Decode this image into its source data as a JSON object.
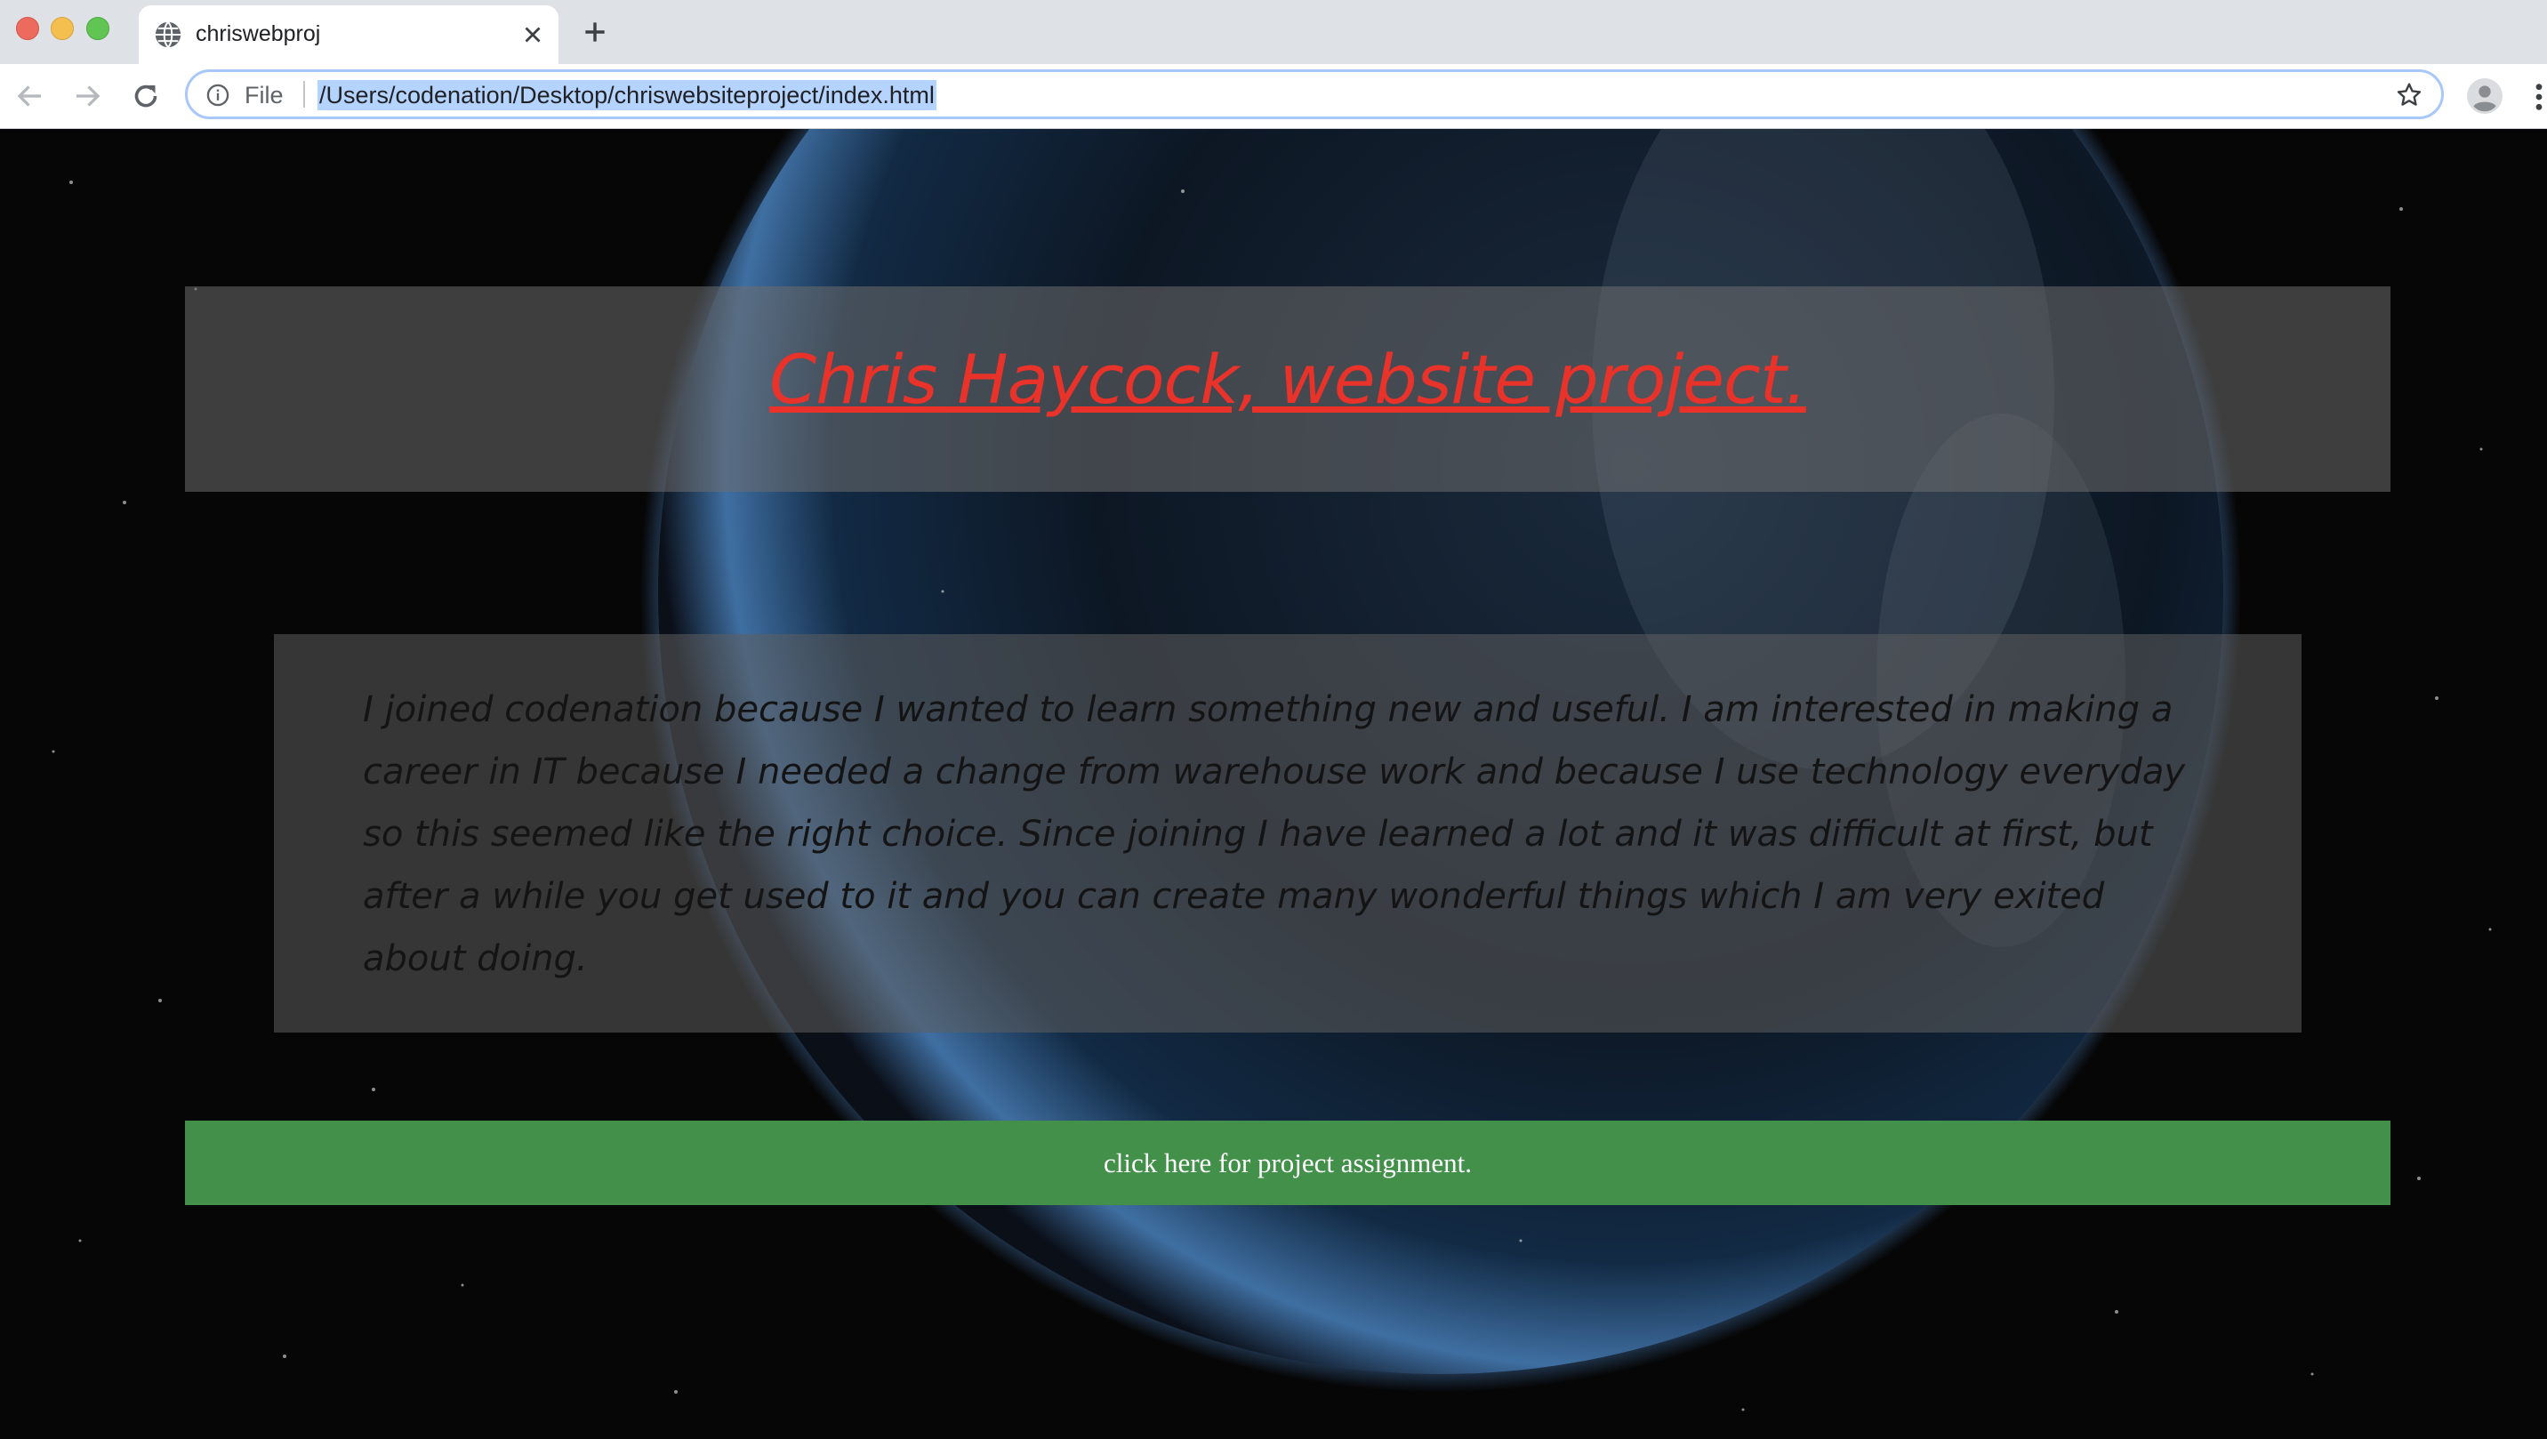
{
  "browser": {
    "tab": {
      "title": "chriswebproj"
    },
    "omnibox": {
      "scheme_label": "File",
      "url": "/Users/codenation/Desktop/chriswebsiteproject/index.html"
    }
  },
  "page": {
    "title": "Chris Haycock, website project.",
    "about_text": "I joined codenation because I wanted to learn something new and useful. I am interested in making a career in IT because I needed a change from warehouse work and because I use technology everyday so this seemed like the right choice. Since joining I have learned a lot and it was difficult at first, but after a while you get used to it and you can create many wonderful things which I am very exited about doing.",
    "cta_label": "click here for project assignment."
  },
  "colors": {
    "title": "#e8322a",
    "cta_background": "#43904b",
    "url_selection": "#b4d3ff"
  },
  "icons": {
    "favicon": "globe-icon",
    "tab_close": "close-icon",
    "new_tab": "plus-icon",
    "back": "arrow-left-icon",
    "forward": "arrow-right-icon",
    "reload": "reload-icon",
    "site_info": "info-icon",
    "bookmark": "star-icon",
    "profile": "profile-icon",
    "menu": "kebab-menu-icon"
  }
}
